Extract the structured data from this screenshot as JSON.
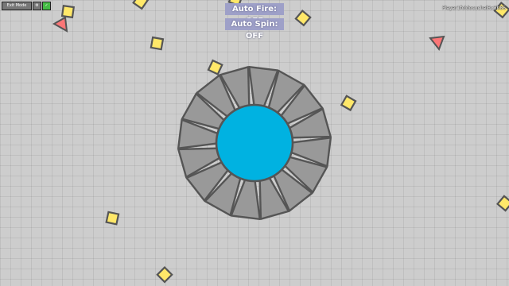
{
  "buttons": {
    "auto_fire": "Auto Fire: OFF",
    "auto_spin": "Auto Spin: OFF"
  },
  "player": {
    "name": "Player1foldocuchelRx3b86"
  },
  "hud": {
    "exit_label": "Exit Mode",
    "settings_icon": "gear-icon",
    "ok_icon": "check-icon"
  },
  "colors": {
    "background": "#cdcdcd",
    "tank_body": "#00b2e1",
    "tank_outline": "#555555",
    "barrel": "#999999",
    "square": "#ffe869",
    "triangle": "#fc7677"
  },
  "objects": {
    "player_tank": "player-tank",
    "squares": 11,
    "triangles": 2
  }
}
